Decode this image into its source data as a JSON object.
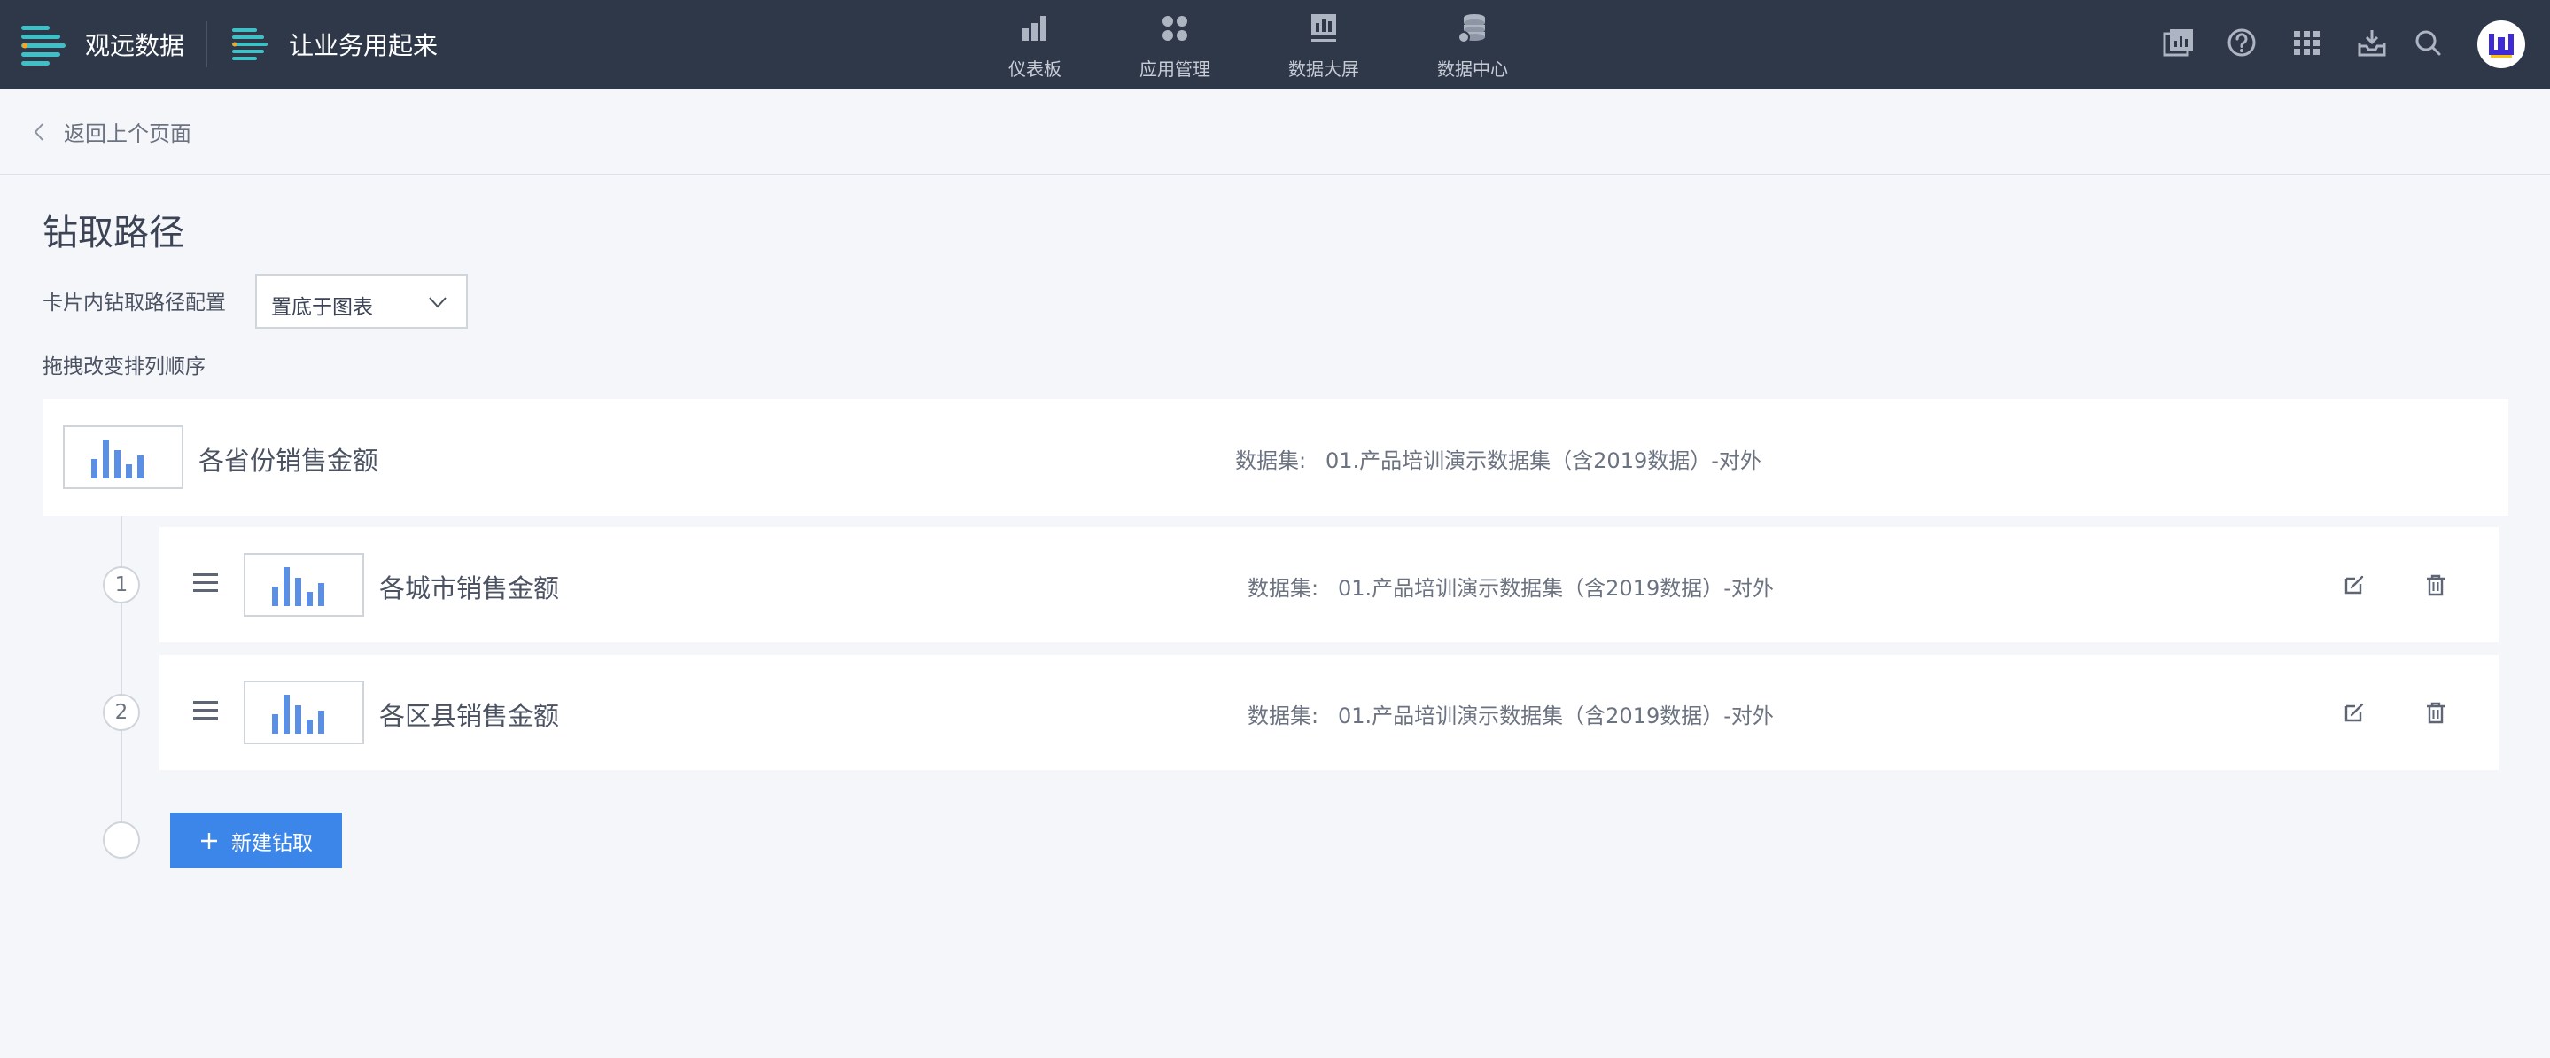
{
  "header": {
    "brand_name": "观远数据",
    "workspace_name": "让业务用起来",
    "nav": [
      {
        "label": "仪表板",
        "icon": "bar-chart-icon"
      },
      {
        "label": "应用管理",
        "icon": "apps-icon"
      },
      {
        "label": "数据大屏",
        "icon": "screen-icon"
      },
      {
        "label": "数据中心",
        "icon": "database-icon"
      }
    ],
    "tools": [
      "report-icon",
      "help-icon",
      "grid-icon",
      "inbox-icon",
      "search-icon"
    ],
    "avatar_letter": "W"
  },
  "breadcrumb": {
    "back_label": "返回上个页面"
  },
  "page": {
    "title": "钻取路径",
    "config_label": "卡片内钻取路径配置",
    "config_value": "置底于图表",
    "drag_hint": "拖拽改变排列顺序"
  },
  "root_card": {
    "title": "各省份销售金额",
    "dataset_label": "数据集:",
    "dataset_value": "01.产品培训演示数据集（含2019数据）-对外"
  },
  "drill_levels": [
    {
      "index": "1",
      "title": "各城市销售金额",
      "dataset_label": "数据集:",
      "dataset_value": "01.产品培训演示数据集（含2019数据）-对外"
    },
    {
      "index": "2",
      "title": "各区县销售金额",
      "dataset_label": "数据集:",
      "dataset_value": "01.产品培训演示数据集（含2019数据）-对外"
    }
  ],
  "new_drill_label": "新建钻取",
  "colors": {
    "topbar": "#2f3849",
    "accent": "#3b86e8",
    "brand_teal": "#3fbfc6"
  }
}
